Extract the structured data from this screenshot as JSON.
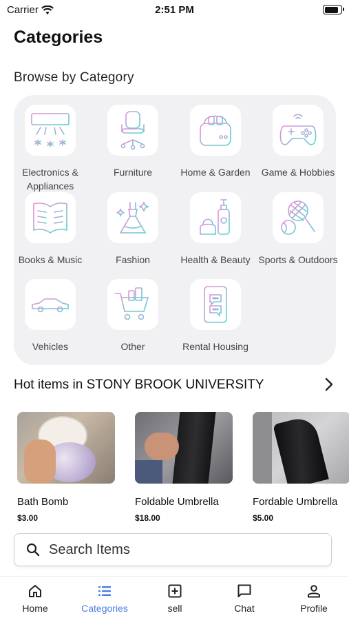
{
  "status_bar": {
    "carrier": "Carrier",
    "time": "2:51 PM",
    "battery_level": 0.9
  },
  "page_title": "Categories",
  "browse_title": "Browse by Category",
  "categories": [
    {
      "label": "Electronics & Appliances",
      "icon": "air-conditioner-icon"
    },
    {
      "label": "Furniture",
      "icon": "office-chair-icon"
    },
    {
      "label": "Home & Garden",
      "icon": "toaster-icon"
    },
    {
      "label": "Game & Hobbies",
      "icon": "gamepad-icon"
    },
    {
      "label": "Books & Music",
      "icon": "open-book-icon"
    },
    {
      "label": "Fashion",
      "icon": "dress-icon"
    },
    {
      "label": "Health & Beauty",
      "icon": "cosmetics-icon"
    },
    {
      "label": "Sports & Outdoors",
      "icon": "tennis-icon"
    },
    {
      "label": "Vehicles",
      "icon": "car-icon"
    },
    {
      "label": "Other",
      "icon": "shopping-cart-icon"
    },
    {
      "label": "Rental Housing",
      "icon": "phone-chat-icon"
    }
  ],
  "hot_items": {
    "title": "Hot items in STONY BROOK UNIVERSITY",
    "items": [
      {
        "name": "Bath Bomb",
        "price": "$3.00"
      },
      {
        "name": "Foldable Umbrella",
        "price": "$18.00"
      },
      {
        "name": "Fordable Umbrella",
        "price": "$5.00"
      }
    ]
  },
  "search": {
    "placeholder": "Search Items"
  },
  "tabs": [
    {
      "label": "Home",
      "icon": "home-icon",
      "active": false
    },
    {
      "label": "Categories",
      "icon": "list-icon",
      "active": true
    },
    {
      "label": "sell",
      "icon": "add-box-icon",
      "active": false
    },
    {
      "label": "Chat",
      "icon": "chat-bubble-icon",
      "active": false
    },
    {
      "label": "Profile",
      "icon": "person-icon",
      "active": false
    }
  ],
  "colors": {
    "accent": "#4a7fe0",
    "panel_bg": "#f1f1f3",
    "icon_gradient_start": "#f08ad8",
    "icon_gradient_end": "#4ed8d0"
  }
}
